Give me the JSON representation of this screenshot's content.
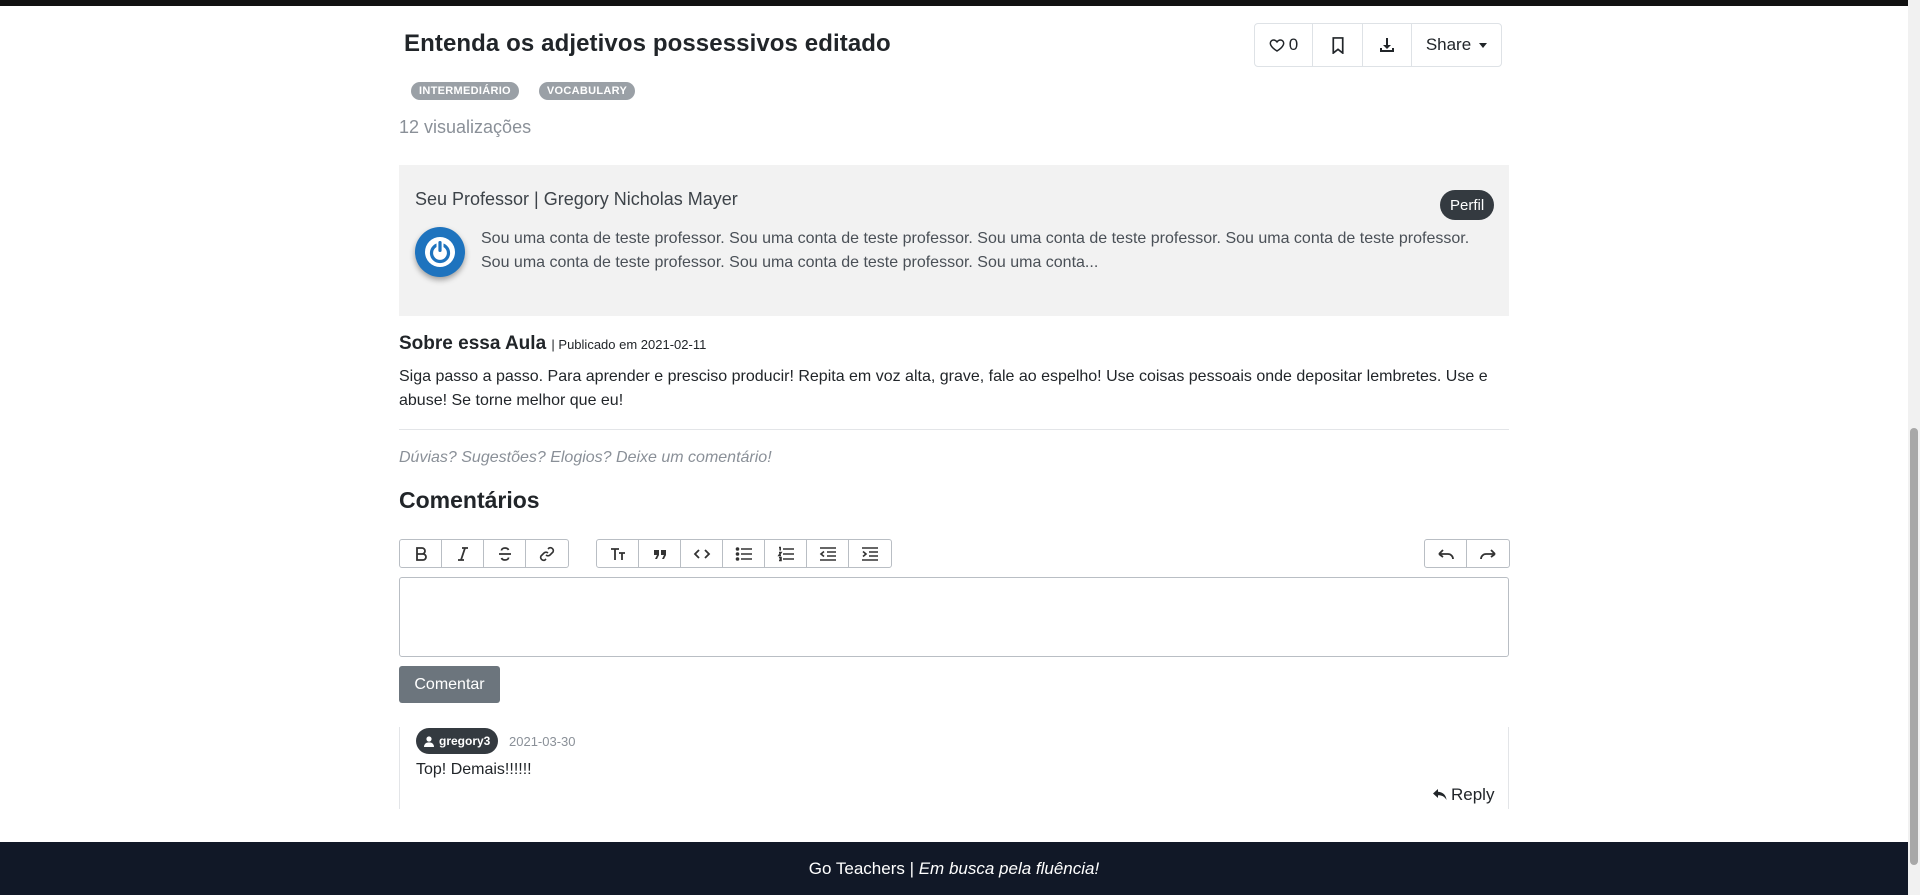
{
  "lesson": {
    "title": "Entenda os adjetivos possessivos editado",
    "tags": [
      "INTERMEDIÁRIO",
      "VOCABULARY"
    ],
    "views": "12 visualizações"
  },
  "actions": {
    "like_count": "0",
    "share_label": "Share"
  },
  "teacher": {
    "heading": "Seu Professor | Gregory Nicholas Mayer",
    "profile_label": "Perfil",
    "bio": "Sou uma conta de teste professor. Sou uma conta de teste professor. Sou uma conta de teste professor. Sou uma conta de teste professor. Sou uma conta de teste professor. Sou uma conta de teste professor. Sou uma conta..."
  },
  "about": {
    "heading": "Sobre essa Aula",
    "published": "| Publicado em 2021-02-11",
    "text": "Siga passo a passo. Para aprender e presciso producir! Repita em voz alta, grave, fale ao espelho! Use coisas pessoais onde depositar lembretes. Use e abuse! Se torne melhor que eu!"
  },
  "comments": {
    "prompt": "Dúvias? Sugestões? Elogios? Deixe um comentário!",
    "title": "Comentários",
    "submit_label": "Comentar",
    "items": [
      {
        "user": "gregory3",
        "date": "2021-03-30",
        "text": "Top! Demais!!!!!!",
        "reply_label": "Reply"
      }
    ]
  },
  "footer": {
    "brand": "Go Teachers | ",
    "slogan": "Em busca pela fluência!"
  },
  "colors": {
    "footer_bg": "#111827",
    "badge_dark": "#343a40",
    "tag_gray": "#9aa0a6",
    "avatar_blue": "#1e73be"
  }
}
